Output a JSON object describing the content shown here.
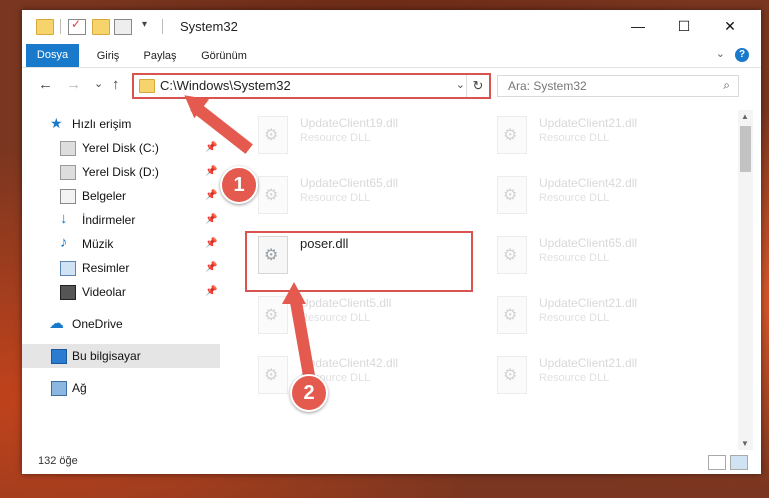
{
  "window": {
    "title": "System32",
    "controls": [
      "—",
      "☐",
      "✕"
    ]
  },
  "ribbon": {
    "tabs": [
      "Dosya",
      "Giriş",
      "Paylaş",
      "Görünüm"
    ],
    "help": "?"
  },
  "navigation": {
    "back": "←",
    "forward": "→",
    "recent": "⌄",
    "up": "↑",
    "address": "C:\\Windows\\System32",
    "search_placeholder": "Ara: System32"
  },
  "sidebar": {
    "quick_access": "Hızlı erişim",
    "items": [
      {
        "label": "Yerel Disk (C:)",
        "icon": "drive-icon"
      },
      {
        "label": "Yerel Disk (D:)",
        "icon": "drive-icon"
      },
      {
        "label": "Belgeler",
        "icon": "documents-icon"
      },
      {
        "label": "İndirmeler",
        "icon": "download-icon"
      },
      {
        "label": "Müzik",
        "icon": "music-icon"
      },
      {
        "label": "Resimler",
        "icon": "pictures-icon"
      },
      {
        "label": "Videolar",
        "icon": "videos-icon"
      }
    ],
    "onedrive": "OneDrive",
    "this_pc": "Bu bilgisayar",
    "network": "Ağ"
  },
  "files": [
    {
      "name": "UpdateClient19.dll",
      "type": "Resource DLL"
    },
    {
      "name": "UpdateClient21.dll",
      "type": "Resource DLL"
    },
    {
      "name": "UpdateClient65.dll",
      "type": "Resource DLL"
    },
    {
      "name": "UpdateClient42.dll",
      "type": "Resource DLL"
    },
    {
      "name": "poser.dll",
      "type": ""
    },
    {
      "name": "UpdateClient65.dll",
      "type": "Resource DLL"
    },
    {
      "name": "UpdateClient5.dll",
      "type": "Resource DLL"
    },
    {
      "name": "UpdateClient21.dll",
      "type": "Resource DLL"
    },
    {
      "name": "UpdateClient42.dll",
      "type": "Resource DLL"
    },
    {
      "name": "UpdateClient21.dll",
      "type": "Resource DLL"
    }
  ],
  "status": {
    "count": "132 öğe"
  },
  "callouts": [
    "1",
    "2"
  ],
  "colors": {
    "accent": "#1979ca",
    "callout": "#e45a4f",
    "highlight_border": "#d9534f"
  }
}
